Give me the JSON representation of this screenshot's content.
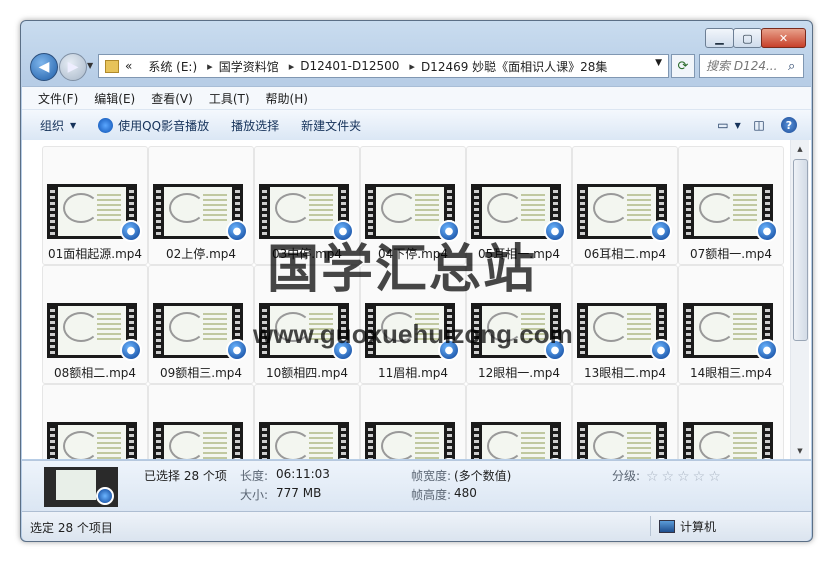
{
  "window": {
    "min": "▁",
    "max": "▢",
    "close": "✕"
  },
  "address": {
    "overflow": "«",
    "crumbs": [
      "系统 (E:)",
      "国学资料馆",
      "D12401-D12500",
      "D12469 妙聪《面相识人课》28集"
    ],
    "search_placeholder": "搜索 D124..."
  },
  "menu": [
    "文件(F)",
    "编辑(E)",
    "查看(V)",
    "工具(T)",
    "帮助(H)"
  ],
  "toolbar": {
    "organize": "组织",
    "play_qq": "使用QQ影音播放",
    "play_selection": "播放选择",
    "new_folder": "新建文件夹"
  },
  "files": [
    "01面相起源.mp4",
    "02上停.mp4",
    "03中停.mp4",
    "04下停.mp4",
    "05耳相一.mp4",
    "06耳相二.mp4",
    "07额相一.mp4",
    "08额相二.mp4",
    "09额相三.mp4",
    "10额相四.mp4",
    "11眉相.mp4",
    "12眼相一.mp4",
    "13眼相二.mp4",
    "14眼相三.mp4",
    "",
    "",
    "",
    "",
    "",
    "",
    ""
  ],
  "watermark": {
    "text": "国学汇总站",
    "url": "www.guoxuehuizong.com"
  },
  "details": {
    "selected": "已选择 28 个项",
    "length_label": "长度:",
    "length": "06:11:03",
    "size_label": "大小:",
    "size": "777 MB",
    "frame_width_label": "帧宽度:",
    "frame_width": "(多个数值)",
    "frame_height_label": "帧高度:",
    "frame_height": "480",
    "rating_label": "分级:",
    "rating_stars": "☆☆☆☆☆"
  },
  "status": {
    "selected": "选定 28 个项目",
    "computer": "计算机"
  }
}
